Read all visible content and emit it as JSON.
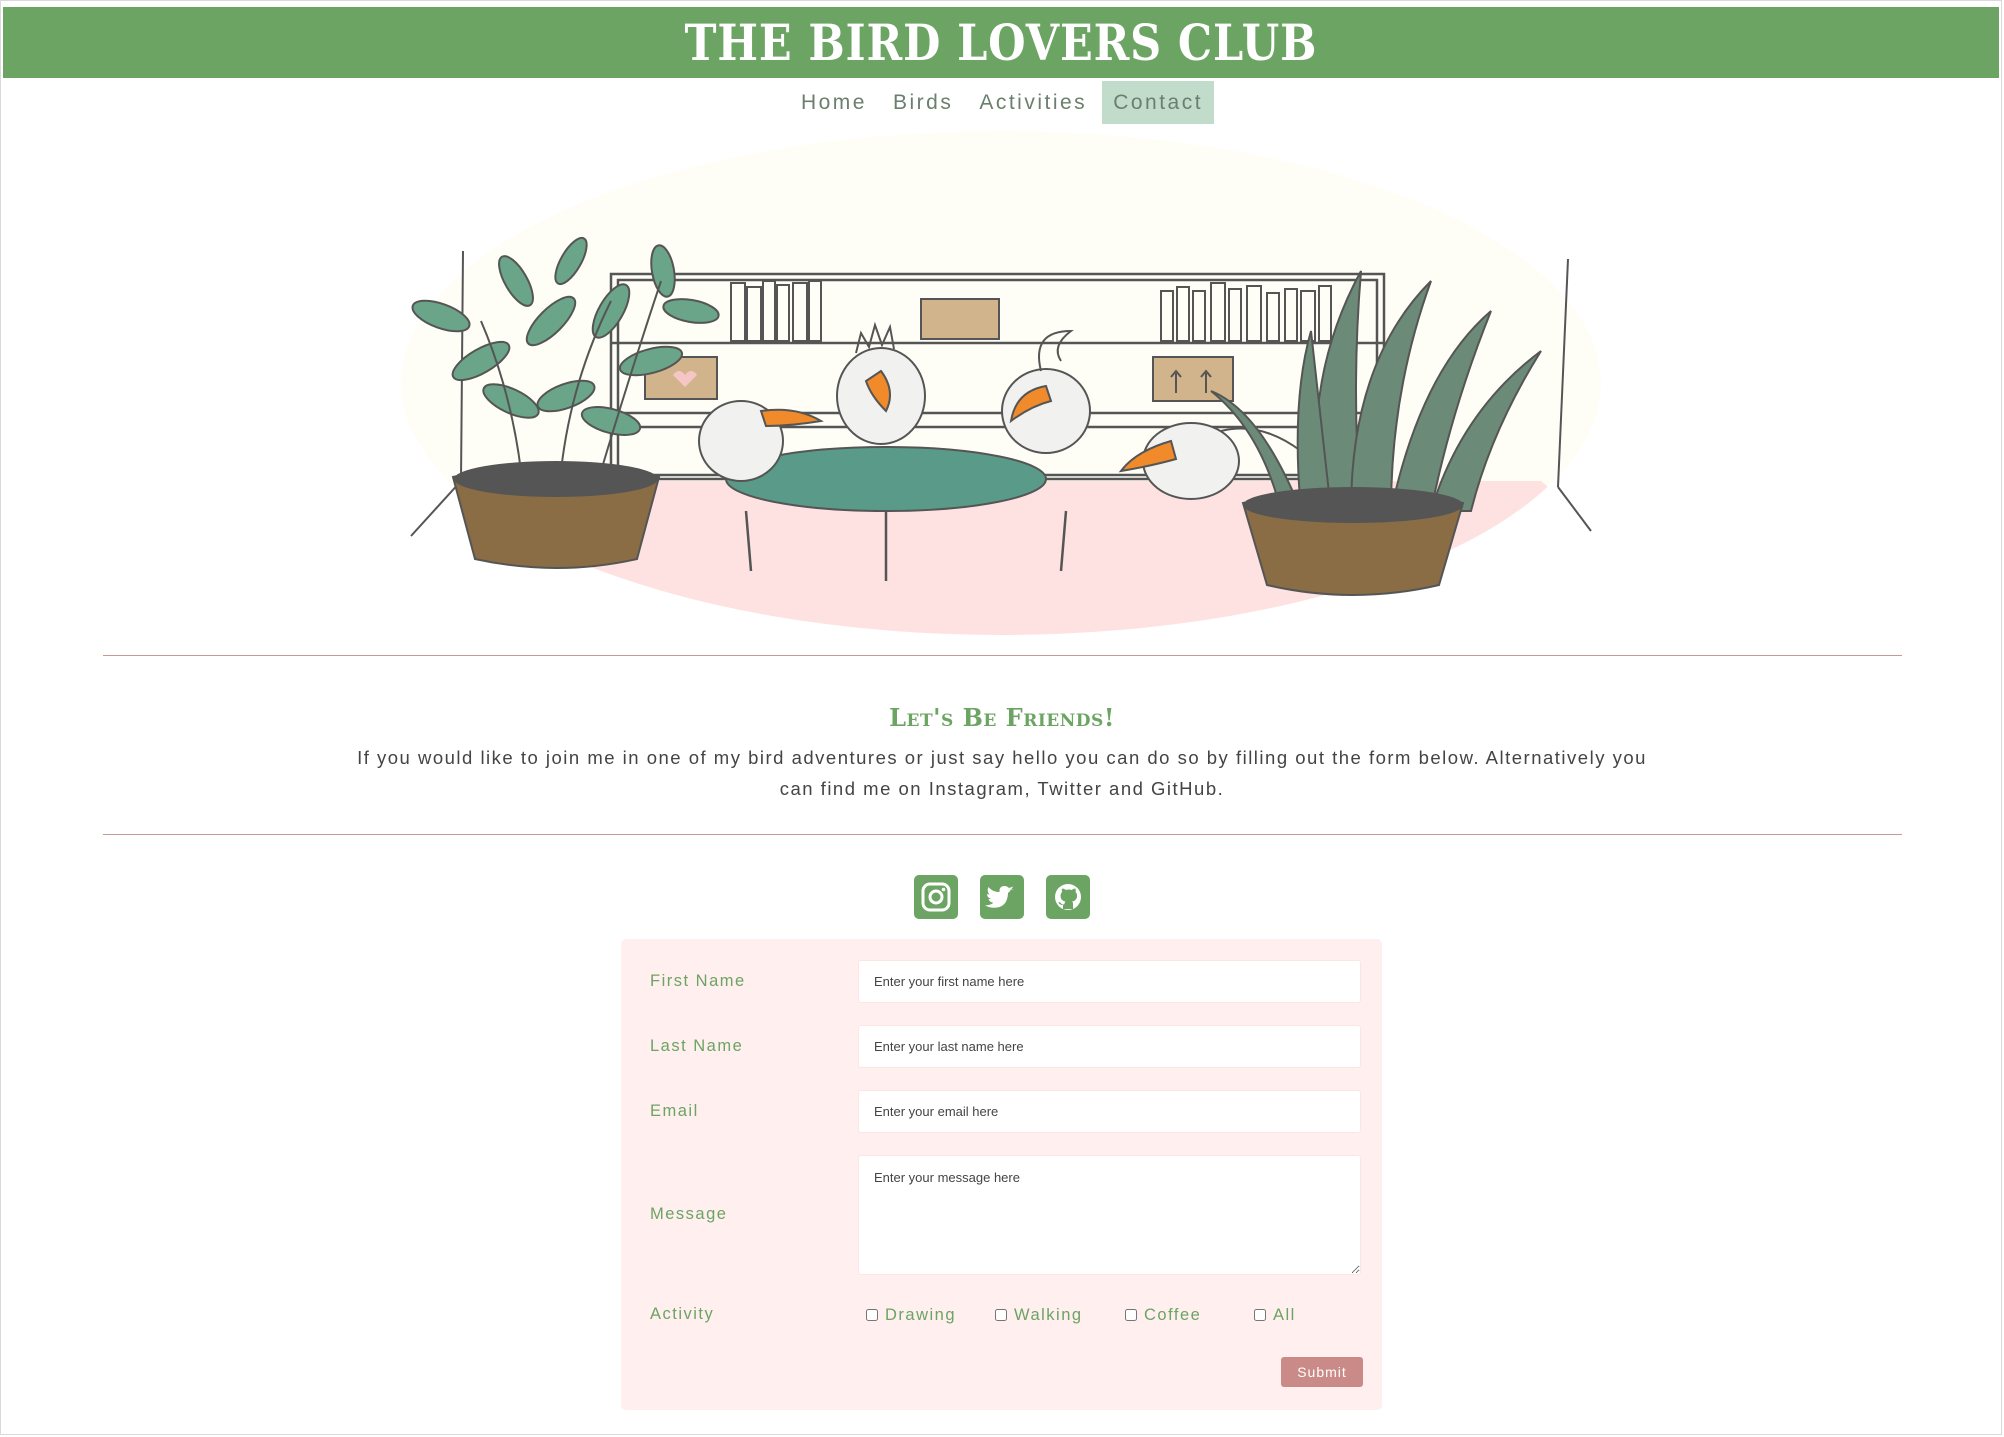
{
  "site": {
    "title": "THE BIRD LOVERS CLUB"
  },
  "nav": {
    "items": [
      {
        "label": "Home"
      },
      {
        "label": "Birds"
      },
      {
        "label": "Activities"
      },
      {
        "label": "Contact",
        "active": true
      }
    ]
  },
  "hero": {
    "image": "illustration of four cartoon birds sitting around a green table with potted plants and bookshelves"
  },
  "friends": {
    "title": "Let's Be Friends!",
    "text": "If you would like to join me in one of my bird adventures or just say hello you can do so by filling out the form below. Alternatively you can find me on Instagram, Twitter and GitHub."
  },
  "social": {
    "icons": [
      "instagram-icon",
      "twitter-icon",
      "github-icon"
    ]
  },
  "form": {
    "first_name": {
      "label": "First Name",
      "placeholder": "Enter your first name here"
    },
    "last_name": {
      "label": "Last Name",
      "placeholder": "Enter your last name here"
    },
    "email": {
      "label": "Email",
      "placeholder": "Enter your email here"
    },
    "message": {
      "label": "Message",
      "placeholder": "Enter your message here"
    },
    "activity": {
      "label": "Activity",
      "options": [
        "Drawing",
        "Walking",
        "Coffee",
        "All"
      ]
    },
    "submit": "Submit"
  },
  "colors": {
    "brand_green": "#6ca463",
    "active_tab": "#c2dccb",
    "form_bg": "#ffefee",
    "submit_bg": "#c98a88",
    "rule": "#c99a94"
  }
}
